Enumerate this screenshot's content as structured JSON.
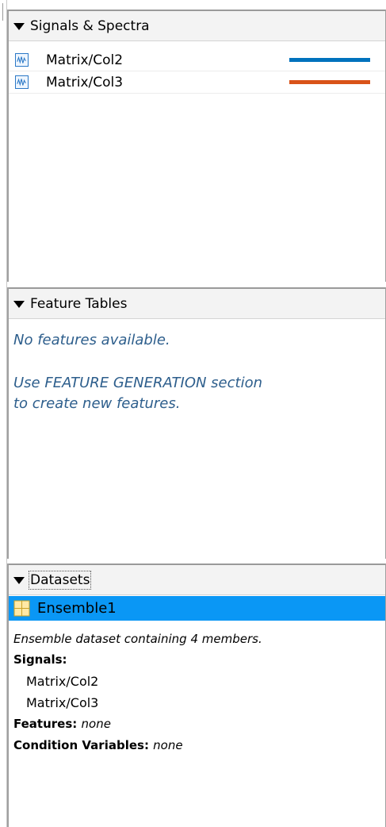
{
  "signals_panel": {
    "title": "Signals & Spectra",
    "items": [
      {
        "label": "Matrix/Col2",
        "color": "#0072bd"
      },
      {
        "label": "Matrix/Col3",
        "color": "#d95319"
      }
    ]
  },
  "features_panel": {
    "title": "Feature Tables",
    "message_line1": "No features available.",
    "message_line2": "Use FEATURE GENERATION section",
    "message_line3": "to create new features."
  },
  "datasets_panel": {
    "title": "Datasets",
    "selected_item": "Ensemble1",
    "selected_color": "#0a97f5",
    "description": "Ensemble dataset containing 4 members.",
    "signals_label": "Signals:",
    "signals": [
      "Matrix/Col2",
      "Matrix/Col3"
    ],
    "features_label": "Features:",
    "features_value": "none",
    "condition_label": "Condition Variables:",
    "condition_value": "none"
  }
}
